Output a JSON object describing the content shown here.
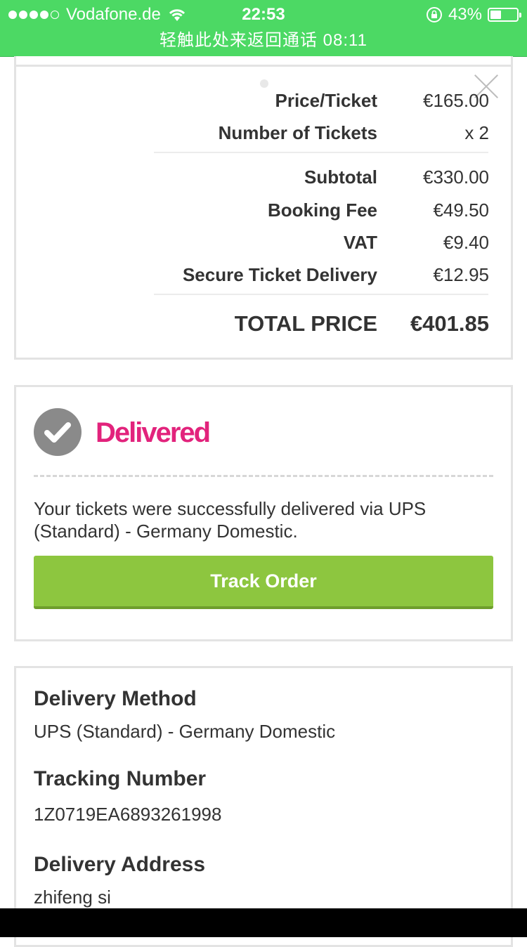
{
  "status_bar": {
    "carrier": "Vodafone.de",
    "time": "22:53",
    "battery": "43%",
    "battery_level": 0.43,
    "call_banner": "轻触此处来返回通话  08:11",
    "color": "#4cd964"
  },
  "price_summary": {
    "rows": [
      {
        "label": "Price/Ticket",
        "value": "€165.00"
      },
      {
        "label": "Number of Tickets",
        "value": "x 2"
      },
      {
        "label": "Subtotal",
        "value": "€330.00"
      },
      {
        "label": "Booking Fee",
        "value": "€49.50"
      },
      {
        "label": "VAT",
        "value": "€9.40"
      },
      {
        "label": "Secure Ticket Delivery",
        "value": "€12.95"
      }
    ],
    "total_label": "TOTAL PRICE",
    "total_value": "€401.85"
  },
  "delivery_status": {
    "status": "Delivered",
    "status_color": "#e2237c",
    "message": "Your tickets were successfully delivered via UPS (Standard) - Germany Domestic.",
    "track_button": "Track Order",
    "button_color": "#8dc63f"
  },
  "delivery_info": {
    "method_title": "Delivery Method",
    "method_value": "UPS (Standard) - Germany Domestic",
    "tracking_title": "Tracking Number",
    "tracking_value": "1Z0719EA6893261998",
    "address_title": "Delivery Address",
    "address_value": "zhifeng si"
  }
}
